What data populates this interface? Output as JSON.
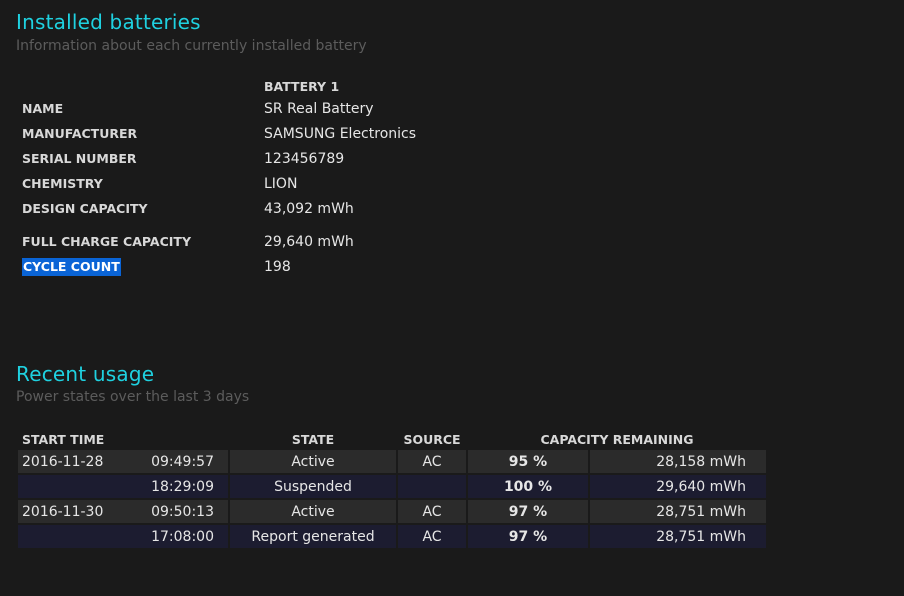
{
  "installed": {
    "title": "Installed batteries",
    "subtitle": "Information about each currently installed battery",
    "column_header": "BATTERY 1",
    "rows": [
      {
        "label": "NAME",
        "value": "SR Real Battery"
      },
      {
        "label": "MANUFACTURER",
        "value": "SAMSUNG Electronics"
      },
      {
        "label": "SERIAL NUMBER",
        "value": "123456789"
      },
      {
        "label": "CHEMISTRY",
        "value": "LION"
      },
      {
        "label": "DESIGN CAPACITY",
        "value": "43,092 mWh"
      },
      {
        "label": "FULL CHARGE CAPACITY",
        "value": "29,640 mWh"
      },
      {
        "label": "CYCLE COUNT",
        "value": "198"
      }
    ]
  },
  "usage": {
    "title": "Recent usage",
    "subtitle": "Power states over the last 3 days",
    "headers": {
      "start_time": "START TIME",
      "state": "STATE",
      "source": "SOURCE",
      "capacity": "CAPACITY REMAINING"
    },
    "rows": [
      {
        "date": "2016-11-28",
        "time": "09:49:57",
        "state": "Active",
        "source": "AC",
        "percent": "95 %",
        "capacity": "28,158 mWh"
      },
      {
        "date": "",
        "time": "18:29:09",
        "state": "Suspended",
        "source": "",
        "percent": "100 %",
        "capacity": "29,640 mWh"
      },
      {
        "date": "2016-11-30",
        "time": "09:50:13",
        "state": "Active",
        "source": "AC",
        "percent": "97 %",
        "capacity": "28,751 mWh"
      },
      {
        "date": "",
        "time": "17:08:00",
        "state": "Report generated",
        "source": "AC",
        "percent": "97 %",
        "capacity": "28,751 mWh"
      }
    ]
  },
  "colors": {
    "accent": "#1fd1e0",
    "selection": "#0a64d6",
    "background": "#1a1a1a"
  }
}
